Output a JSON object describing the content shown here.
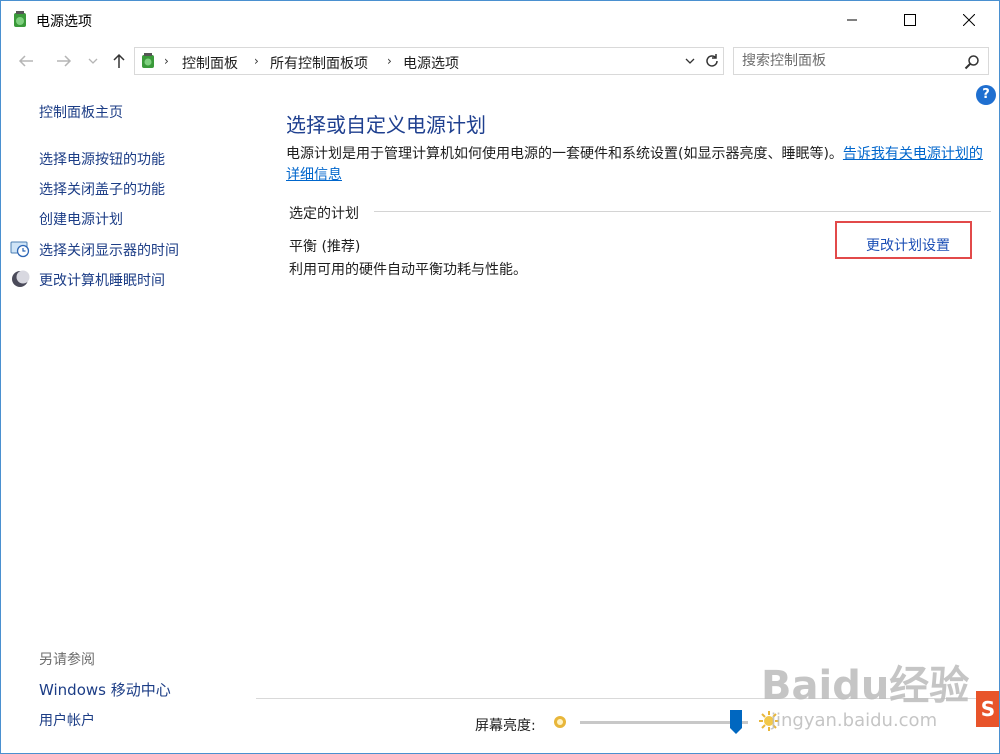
{
  "window": {
    "title": "电源选项",
    "controls": {
      "minimize_icon": "minimize-icon",
      "maximize_icon": "maximize-icon",
      "close_icon": "close-icon"
    }
  },
  "navigation": {
    "back_icon": "arrow-left-icon",
    "forward_icon": "arrow-right-icon",
    "recent_icon": "chevron-down-icon",
    "up_icon": "arrow-up-icon",
    "breadcrumb": [
      "控制面板",
      "所有控制面板项",
      "电源选项"
    ],
    "refresh_icon": "refresh-icon"
  },
  "search": {
    "placeholder": "搜索控制面板",
    "value": ""
  },
  "sidebar": {
    "home": "控制面板主页",
    "links": [
      {
        "label": "选择电源按钮的功能",
        "icon": ""
      },
      {
        "label": "选择关闭盖子的功能",
        "icon": ""
      },
      {
        "label": "创建电源计划",
        "icon": ""
      },
      {
        "label": "选择关闭显示器的时间",
        "icon": "monitor-clock-icon"
      },
      {
        "label": "更改计算机睡眠时间",
        "icon": "moon-icon"
      }
    ],
    "see_also": {
      "heading": "另请参阅",
      "links": [
        "Windows 移动中心",
        "用户帐户"
      ]
    }
  },
  "main": {
    "title": "选择或自定义电源计划",
    "description": "电源计划是用于管理计算机如何使用电源的一套硬件和系统设置(如显示器亮度、睡眠等)。",
    "description_link": "告诉我有关电源计划的详细信息",
    "selected_plan_label": "选定的计划",
    "plan": {
      "name": "平衡 (推荐)",
      "description": "利用可用的硬件自动平衡功耗与性能。",
      "change_link": "更改计划设置"
    }
  },
  "brightness": {
    "label": "屏幕亮度:",
    "level_percent": 93
  },
  "watermark": {
    "logo": "Baidu经验",
    "url": "jingyan.baidu.com"
  },
  "colors": {
    "link": "#1c3d86",
    "title": "#1e3f8f",
    "highlight_border": "#e24a4a",
    "window_border": "#4a90d0"
  }
}
